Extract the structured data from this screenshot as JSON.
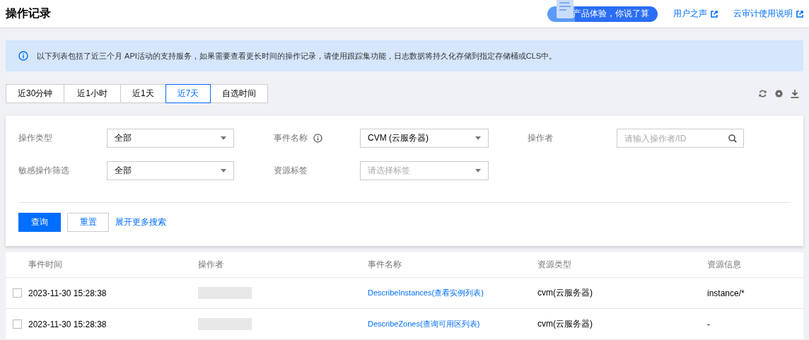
{
  "header": {
    "title": "操作记录",
    "promo": "产品体验，你说了算",
    "links": [
      "用户之声",
      "云审计使用说明"
    ]
  },
  "notice": "以下列表包括了近三个月 API活动的支持服务，如果需要查看更长时间的操作记录，请使用跟踪集功能，日志数据将持久化存储到指定存储桶或CLS中。",
  "time_tabs": [
    {
      "label": "近30分钟",
      "selected": false
    },
    {
      "label": "近1小时",
      "selected": false
    },
    {
      "label": "近1天",
      "selected": false
    },
    {
      "label": "近7天",
      "selected": true
    },
    {
      "label": "自选时间",
      "selected": false
    }
  ],
  "filters": [
    {
      "label": "操作类型",
      "kind": "select",
      "value": "全部",
      "info": false
    },
    {
      "label": "事件名称",
      "kind": "select",
      "value": "CVM (云服务器)",
      "info": true
    },
    {
      "label": "操作者",
      "kind": "search",
      "placeholder": "请输入操作者/ID",
      "info": false
    },
    {
      "label": "敏感操作筛选",
      "kind": "select",
      "value": "全部",
      "info": false
    },
    {
      "label": "资源标签",
      "kind": "select",
      "placeholder": "请选择标签",
      "info": false
    }
  ],
  "actions": {
    "query": "查询",
    "reset": "重置",
    "more": "展开更多搜索"
  },
  "table": {
    "columns": [
      "事件时间",
      "操作者",
      "事件名称",
      "资源类型",
      "资源信息"
    ],
    "rows": [
      {
        "checked": false,
        "time": "2023-11-30 15:28:38",
        "operator_hidden": true,
        "event": "DescribeInstances(查看实例列表)",
        "resource_type": "cvm(云服务器)",
        "resource_info": "instance/*"
      },
      {
        "checked": false,
        "time": "2023-11-30 15:28:38",
        "operator_hidden": true,
        "event": "DescribeZones(查询可用区列表)",
        "resource_type": "cvm(云服务器)",
        "resource_info": "-"
      }
    ]
  }
}
